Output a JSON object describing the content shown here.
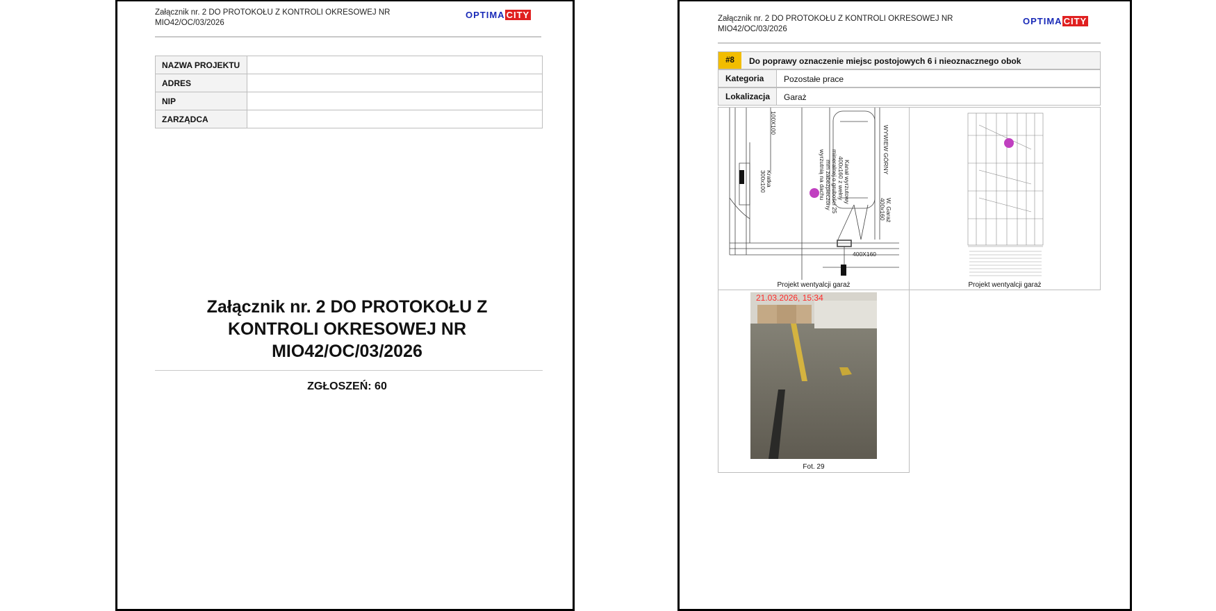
{
  "header": {
    "line1": "Załącznik nr. 2 DO PROTOKOŁU Z KONTROLI OKRESOWEJ NR",
    "line2": "MIO42/OC/03/2026",
    "logo_part1": "OPTIMA",
    "logo_part2": "CITY"
  },
  "page1": {
    "info_table": [
      {
        "label": "NAZWA PROJEKTU",
        "value": ""
      },
      {
        "label": "ADRES",
        "value": ""
      },
      {
        "label": "NIP",
        "value": ""
      },
      {
        "label": "ZARZĄDCA",
        "value": ""
      }
    ],
    "title_line1": "Załącznik nr. 2 DO PROTOKOŁU Z",
    "title_line2": "KONTROLI OKRESOWEJ NR",
    "title_line3": "MIO42/OC/03/2026",
    "count_text": "ZGŁOSZEŃ: 60"
  },
  "page2": {
    "issue": {
      "number": "#8",
      "title": "Do poprawy oznaczenie miejsc postojowych 6 i nieoznacznego obok",
      "category_label": "Kategoria",
      "category_value": "Pozostałe prace",
      "location_label": "Lokalizacja",
      "location_value": "Garaż"
    },
    "images": [
      {
        "caption": "Projekt wentyalcji garaż",
        "drawing_labels": [
          "100X100",
          "Kratka",
          "300x100",
          "WYWIEW GÓRNY",
          "Kanał wyrzutowy",
          "400x160 z wełny",
          "mineralnej o grubości 25",
          "mm zabezpieczony",
          "wyrzutnią na dachu",
          "W. Garaż",
          "400x160",
          "400X160"
        ]
      },
      {
        "caption": "Projekt wentyalcji garaż"
      },
      {
        "caption": "Fot. 29",
        "stamp": "21.03.2026, 15:34"
      }
    ],
    "marker_color": "#c040c0"
  }
}
